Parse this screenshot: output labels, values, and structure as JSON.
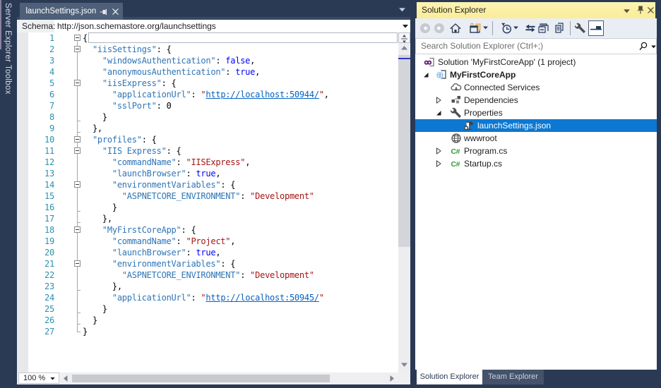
{
  "colors": {
    "navy": "#2B3A54",
    "band": "#3A4963",
    "tab_active": "#4E5F79",
    "gold": "#FCF0A4",
    "selection_blue": "#0D78D1",
    "line_number": "#2B91AF",
    "json_key": "#2E75B6",
    "json_string": "#A31515",
    "json_keyword": "#0000FF",
    "json_url": "#0563C1"
  },
  "sidebar": {
    "tabs": [
      {
        "label": "Server Explorer"
      },
      {
        "label": "Toolbox"
      }
    ]
  },
  "editor": {
    "tab": {
      "title": "launchSettings.json"
    },
    "schema": {
      "label": "Schema:",
      "value": "http://json.schemastore.org/launchsettings"
    },
    "zoom": {
      "value": "100 %"
    },
    "code": {
      "lines": [
        {
          "n": 1,
          "fold": true,
          "segs": [
            [
              "p",
              "{"
            ]
          ]
        },
        {
          "n": 2,
          "fold": true,
          "segs": [
            [
              "p",
              "  "
            ],
            [
              "k",
              "\"iisSettings\""
            ],
            [
              "p",
              ": {"
            ]
          ]
        },
        {
          "n": 3,
          "segs": [
            [
              "p",
              "    "
            ],
            [
              "k",
              "\"windowsAuthentication\""
            ],
            [
              "p",
              ": "
            ],
            [
              "b",
              "false"
            ],
            [
              "p",
              ","
            ]
          ]
        },
        {
          "n": 4,
          "segs": [
            [
              "p",
              "    "
            ],
            [
              "k",
              "\"anonymousAuthentication\""
            ],
            [
              "p",
              ": "
            ],
            [
              "b",
              "true"
            ],
            [
              "p",
              ","
            ]
          ]
        },
        {
          "n": 5,
          "fold": true,
          "segs": [
            [
              "p",
              "    "
            ],
            [
              "k",
              "\"iisExpress\""
            ],
            [
              "p",
              ": {"
            ]
          ]
        },
        {
          "n": 6,
          "segs": [
            [
              "p",
              "      "
            ],
            [
              "k",
              "\"applicationUrl\""
            ],
            [
              "p",
              ": "
            ],
            [
              "s",
              "\""
            ],
            [
              "u",
              "http://localhost:50944/"
            ],
            [
              "s",
              "\""
            ],
            [
              "p",
              ","
            ]
          ]
        },
        {
          "n": 7,
          "segs": [
            [
              "p",
              "      "
            ],
            [
              "k",
              "\"sslPort\""
            ],
            [
              "p",
              ": "
            ],
            [
              "n",
              "0"
            ]
          ]
        },
        {
          "n": 8,
          "end": true,
          "segs": [
            [
              "p",
              "    }"
            ]
          ]
        },
        {
          "n": 9,
          "end": true,
          "segs": [
            [
              "p",
              "  },"
            ]
          ]
        },
        {
          "n": 10,
          "fold": true,
          "segs": [
            [
              "p",
              "  "
            ],
            [
              "k",
              "\"profiles\""
            ],
            [
              "p",
              ": {"
            ]
          ]
        },
        {
          "n": 11,
          "fold": true,
          "segs": [
            [
              "p",
              "    "
            ],
            [
              "k",
              "\"IIS Express\""
            ],
            [
              "p",
              ": {"
            ]
          ]
        },
        {
          "n": 12,
          "segs": [
            [
              "p",
              "      "
            ],
            [
              "k",
              "\"commandName\""
            ],
            [
              "p",
              ": "
            ],
            [
              "s",
              "\"IISExpress\""
            ],
            [
              "p",
              ","
            ]
          ]
        },
        {
          "n": 13,
          "segs": [
            [
              "p",
              "      "
            ],
            [
              "k",
              "\"launchBrowser\""
            ],
            [
              "p",
              ": "
            ],
            [
              "b",
              "true"
            ],
            [
              "p",
              ","
            ]
          ]
        },
        {
          "n": 14,
          "fold": true,
          "segs": [
            [
              "p",
              "      "
            ],
            [
              "k",
              "\"environmentVariables\""
            ],
            [
              "p",
              ": {"
            ]
          ]
        },
        {
          "n": 15,
          "segs": [
            [
              "p",
              "        "
            ],
            [
              "k",
              "\"ASPNETCORE_ENVIRONMENT\""
            ],
            [
              "p",
              ": "
            ],
            [
              "s",
              "\"Development\""
            ]
          ]
        },
        {
          "n": 16,
          "end": true,
          "segs": [
            [
              "p",
              "      }"
            ]
          ]
        },
        {
          "n": 17,
          "end": true,
          "segs": [
            [
              "p",
              "    },"
            ]
          ]
        },
        {
          "n": 18,
          "fold": true,
          "segs": [
            [
              "p",
              "    "
            ],
            [
              "k",
              "\"MyFirstCoreApp\""
            ],
            [
              "p",
              ": {"
            ]
          ]
        },
        {
          "n": 19,
          "segs": [
            [
              "p",
              "      "
            ],
            [
              "k",
              "\"commandName\""
            ],
            [
              "p",
              ": "
            ],
            [
              "s",
              "\"Project\""
            ],
            [
              "p",
              ","
            ]
          ]
        },
        {
          "n": 20,
          "segs": [
            [
              "p",
              "      "
            ],
            [
              "k",
              "\"launchBrowser\""
            ],
            [
              "p",
              ": "
            ],
            [
              "b",
              "true"
            ],
            [
              "p",
              ","
            ]
          ]
        },
        {
          "n": 21,
          "fold": true,
          "segs": [
            [
              "p",
              "      "
            ],
            [
              "k",
              "\"environmentVariables\""
            ],
            [
              "p",
              ": {"
            ]
          ]
        },
        {
          "n": 22,
          "segs": [
            [
              "p",
              "        "
            ],
            [
              "k",
              "\"ASPNETCORE_ENVIRONMENT\""
            ],
            [
              "p",
              ": "
            ],
            [
              "s",
              "\"Development\""
            ]
          ]
        },
        {
          "n": 23,
          "end": true,
          "segs": [
            [
              "p",
              "      },"
            ]
          ]
        },
        {
          "n": 24,
          "segs": [
            [
              "p",
              "      "
            ],
            [
              "k",
              "\"applicationUrl\""
            ],
            [
              "p",
              ": "
            ],
            [
              "s",
              "\""
            ],
            [
              "u",
              "http://localhost:50945/"
            ],
            [
              "s",
              "\""
            ]
          ]
        },
        {
          "n": 25,
          "end": true,
          "segs": [
            [
              "p",
              "    }"
            ]
          ]
        },
        {
          "n": 26,
          "end": true,
          "segs": [
            [
              "p",
              "  }"
            ]
          ]
        },
        {
          "n": 27,
          "end": true,
          "segs": [
            [
              "p",
              "}"
            ]
          ]
        }
      ]
    }
  },
  "solution_explorer": {
    "title": "Solution Explorer",
    "search": {
      "placeholder": "Search Solution Explorer (Ctrl+;)"
    },
    "toolbar": {
      "buttons": [
        "back",
        "forward",
        "home",
        "switch-views",
        "pending-changes-filter",
        "sync-with-active-document",
        "collapse-all",
        "show-all-files",
        "properties",
        "preview-selected-items"
      ]
    },
    "tree": [
      {
        "label": "Solution 'MyFirstCoreApp' (1 project)",
        "icon": "solution",
        "level": 0
      },
      {
        "label": "MyFirstCoreApp",
        "icon": "project",
        "level": 1,
        "bold": true,
        "arrow": "expanded"
      },
      {
        "label": "Connected Services",
        "icon": "cloud",
        "level": 2
      },
      {
        "label": "Dependencies",
        "icon": "dependencies",
        "level": 2,
        "arrow": "collapsed"
      },
      {
        "label": "Properties",
        "icon": "wrench",
        "level": 2,
        "arrow": "expanded"
      },
      {
        "label": "launchSettings.json",
        "icon": "json",
        "level": 3,
        "selected": true
      },
      {
        "label": "wwwroot",
        "icon": "globe",
        "level": 2
      },
      {
        "label": "Program.cs",
        "icon": "csharp",
        "level": 2,
        "arrow": "collapsed"
      },
      {
        "label": "Startup.cs",
        "icon": "csharp",
        "level": 2,
        "arrow": "collapsed"
      }
    ],
    "bottom_tabs": [
      {
        "label": "Solution Explorer",
        "active": true
      },
      {
        "label": "Team Explorer",
        "active": false
      }
    ]
  }
}
